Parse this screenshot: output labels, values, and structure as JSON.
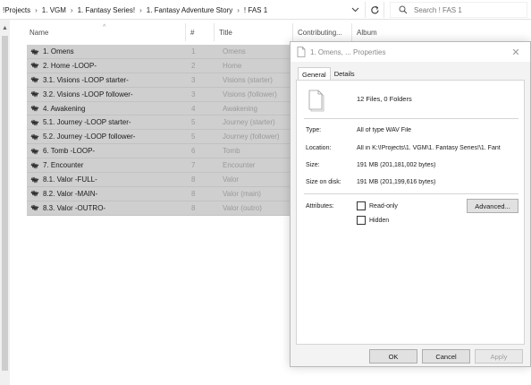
{
  "breadcrumb": {
    "items": [
      "!Projects",
      "1. VGM",
      "1. Fantasy Series!",
      "1. Fantasy Adventure Story",
      "! FAS 1"
    ]
  },
  "search": {
    "placeholder": "Search ! FAS 1"
  },
  "columns": [
    "Name",
    "#",
    "Title",
    "Contributing...",
    "Album"
  ],
  "files": [
    {
      "name": "1. Omens",
      "num": "1",
      "title": "Omens"
    },
    {
      "name": "2. Home -LOOP-",
      "num": "2",
      "title": "Home"
    },
    {
      "name": "3.1. Visions -LOOP starter-",
      "num": "3",
      "title": "Visions (starter)"
    },
    {
      "name": "3.2. Visions -LOOP follower-",
      "num": "3",
      "title": "Visions (follower)"
    },
    {
      "name": "4. Awakening",
      "num": "4",
      "title": "Awakening"
    },
    {
      "name": "5.1. Journey -LOOP starter-",
      "num": "5",
      "title": "Journey (starter)"
    },
    {
      "name": "5.2. Journey -LOOP follower-",
      "num": "5",
      "title": "Journey (follower)"
    },
    {
      "name": "6. Tomb -LOOP-",
      "num": "6",
      "title": "Tomb"
    },
    {
      "name": "7. Encounter",
      "num": "7",
      "title": "Encounter"
    },
    {
      "name": "8.1. Valor -FULL-",
      "num": "8",
      "title": "Valor"
    },
    {
      "name": "8.2. Valor -MAIN-",
      "num": "8",
      "title": "Valor (main)"
    },
    {
      "name": "8.3. Valor -OUTRO-",
      "num": "8",
      "title": "Valor (outro)"
    }
  ],
  "dialog": {
    "title": "1. Omens, ... Properties",
    "tabs": [
      "General",
      "Details"
    ],
    "count_text": "12 Files, 0 Folders",
    "properties": [
      {
        "label": "Type:",
        "value": "All of type WAV File"
      },
      {
        "label": "Location:",
        "value": "All in K:\\!Projects\\1. VGM\\1. Fantasy Series!\\1. Fant"
      },
      {
        "label": "Size:",
        "value": "191 MB (201,181,002 bytes)"
      },
      {
        "label": "Size on disk:",
        "value": "191 MB (201,199,616 bytes)"
      }
    ],
    "attributes_label": "Attributes:",
    "readonly_label": "Read-only",
    "hidden_label": "Hidden",
    "advanced_label": "Advanced...",
    "ok_label": "OK",
    "cancel_label": "Cancel",
    "apply_label": "Apply"
  },
  "colors": {
    "selection": "#cfcfcf",
    "dialog_bg": "#f3f3f3"
  }
}
